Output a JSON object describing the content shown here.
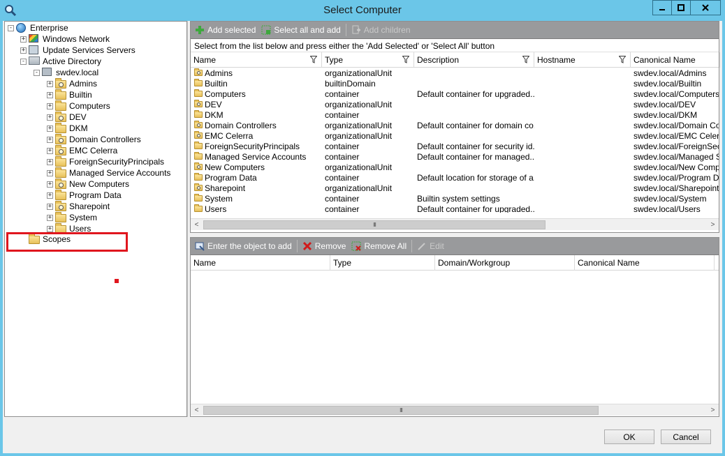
{
  "window": {
    "title": "Select Computer",
    "minimize_icon": "minimize-icon",
    "maximize_icon": "maximize-icon",
    "close_icon": "close-icon"
  },
  "tree": {
    "items": [
      {
        "label": "Enterprise",
        "icon": "globe-icon",
        "expander": "minus",
        "level": 0
      },
      {
        "label": "Windows Network",
        "icon": "network-icon",
        "expander": "plus",
        "level": 1
      },
      {
        "label": "Update Services Servers",
        "icon": "server-icon",
        "expander": "plus",
        "level": 1
      },
      {
        "label": "Active Directory",
        "icon": "directory-icon",
        "expander": "minus",
        "level": 1
      },
      {
        "label": "swdev.local",
        "icon": "domain-icon",
        "expander": "minus",
        "level": 2
      },
      {
        "label": "Admins",
        "icon": "ou-folder-icon",
        "expander": "plus",
        "level": 3
      },
      {
        "label": "Builtin",
        "icon": "folder-icon",
        "expander": "plus",
        "level": 3
      },
      {
        "label": "Computers",
        "icon": "folder-icon",
        "expander": "plus",
        "level": 3
      },
      {
        "label": "DEV",
        "icon": "ou-folder-icon",
        "expander": "plus",
        "level": 3
      },
      {
        "label": "DKM",
        "icon": "folder-icon",
        "expander": "plus",
        "level": 3
      },
      {
        "label": "Domain Controllers",
        "icon": "ou-folder-icon",
        "expander": "plus",
        "level": 3
      },
      {
        "label": "EMC Celerra",
        "icon": "ou-folder-icon",
        "expander": "plus",
        "level": 3
      },
      {
        "label": "ForeignSecurityPrincipals",
        "icon": "folder-icon",
        "expander": "plus",
        "level": 3
      },
      {
        "label": "Managed Service Accounts",
        "icon": "folder-icon",
        "expander": "plus",
        "level": 3
      },
      {
        "label": "New Computers",
        "icon": "ou-folder-icon",
        "expander": "plus",
        "level": 3
      },
      {
        "label": "Program Data",
        "icon": "folder-icon",
        "expander": "plus",
        "level": 3
      },
      {
        "label": "Sharepoint",
        "icon": "ou-folder-icon",
        "expander": "plus",
        "level": 3
      },
      {
        "label": "System",
        "icon": "folder-icon",
        "expander": "plus",
        "level": 3
      },
      {
        "label": "Users",
        "icon": "folder-icon",
        "expander": "plus",
        "level": 3
      },
      {
        "label": "Scopes",
        "icon": "folder-icon",
        "expander": "none",
        "level": 1
      }
    ]
  },
  "top_toolbar": {
    "add_selected": "Add selected",
    "select_all_and_add": "Select all and add",
    "add_children": "Add children"
  },
  "hint": "Select from the list below and press either the 'Add Selected' or 'Select All' button",
  "top_grid": {
    "columns": [
      "Name",
      "Type",
      "Description",
      "Hostname",
      "Canonical Name"
    ],
    "rows": [
      {
        "name": "Admins",
        "type": "organizationalUnit",
        "description": "",
        "hostname": "",
        "canonical": "swdev.local/Admins",
        "ou": true
      },
      {
        "name": "Builtin",
        "type": "builtinDomain",
        "description": "",
        "hostname": "",
        "canonical": "swdev.local/Builtin",
        "ou": false
      },
      {
        "name": "Computers",
        "type": "container",
        "description": "Default container for upgraded...",
        "hostname": "",
        "canonical": "swdev.local/Computers",
        "ou": false
      },
      {
        "name": "DEV",
        "type": "organizationalUnit",
        "description": "",
        "hostname": "",
        "canonical": "swdev.local/DEV",
        "ou": true
      },
      {
        "name": "DKM",
        "type": "container",
        "description": "",
        "hostname": "",
        "canonical": "swdev.local/DKM",
        "ou": false
      },
      {
        "name": "Domain Controllers",
        "type": "organizationalUnit",
        "description": "Default container for domain co...",
        "hostname": "",
        "canonical": "swdev.local/Domain Con",
        "ou": true
      },
      {
        "name": "EMC Celerra",
        "type": "organizationalUnit",
        "description": "",
        "hostname": "",
        "canonical": "swdev.local/EMC Celerra",
        "ou": true
      },
      {
        "name": "ForeignSecurityPrincipals",
        "type": "container",
        "description": "Default container for security id...",
        "hostname": "",
        "canonical": "swdev.local/ForeignSecu",
        "ou": false
      },
      {
        "name": "Managed Service Accounts",
        "type": "container",
        "description": "Default container for managed...",
        "hostname": "",
        "canonical": "swdev.local/Managed Se",
        "ou": false
      },
      {
        "name": "New Computers",
        "type": "organizationalUnit",
        "description": "",
        "hostname": "",
        "canonical": "swdev.local/New Compu",
        "ou": true
      },
      {
        "name": "Program Data",
        "type": "container",
        "description": "Default location for storage of a...",
        "hostname": "",
        "canonical": "swdev.local/Program Da",
        "ou": false
      },
      {
        "name": "Sharepoint",
        "type": "organizationalUnit",
        "description": "",
        "hostname": "",
        "canonical": "swdev.local/Sharepoint",
        "ou": true
      },
      {
        "name": "System",
        "type": "container",
        "description": "Builtin system settings",
        "hostname": "",
        "canonical": "swdev.local/System",
        "ou": false
      },
      {
        "name": "Users",
        "type": "container",
        "description": "Default container for upgraded...",
        "hostname": "",
        "canonical": "swdev.local/Users",
        "ou": false
      }
    ]
  },
  "bottom_toolbar": {
    "enter_object": "Enter the object to add",
    "remove": "Remove",
    "remove_all": "Remove All",
    "edit": "Edit"
  },
  "bottom_grid": {
    "columns": [
      "Name",
      "Type",
      "Domain/Workgroup",
      "Canonical Name"
    ]
  },
  "buttons": {
    "ok": "OK",
    "cancel": "Cancel"
  },
  "scrollbar": {
    "left_arrow": "<",
    "right_arrow": ">",
    "grip": "III"
  },
  "colors": {
    "titlebar": "#6bc6e8",
    "toolbar": "#999a9c",
    "highlight": "#e0161e"
  }
}
